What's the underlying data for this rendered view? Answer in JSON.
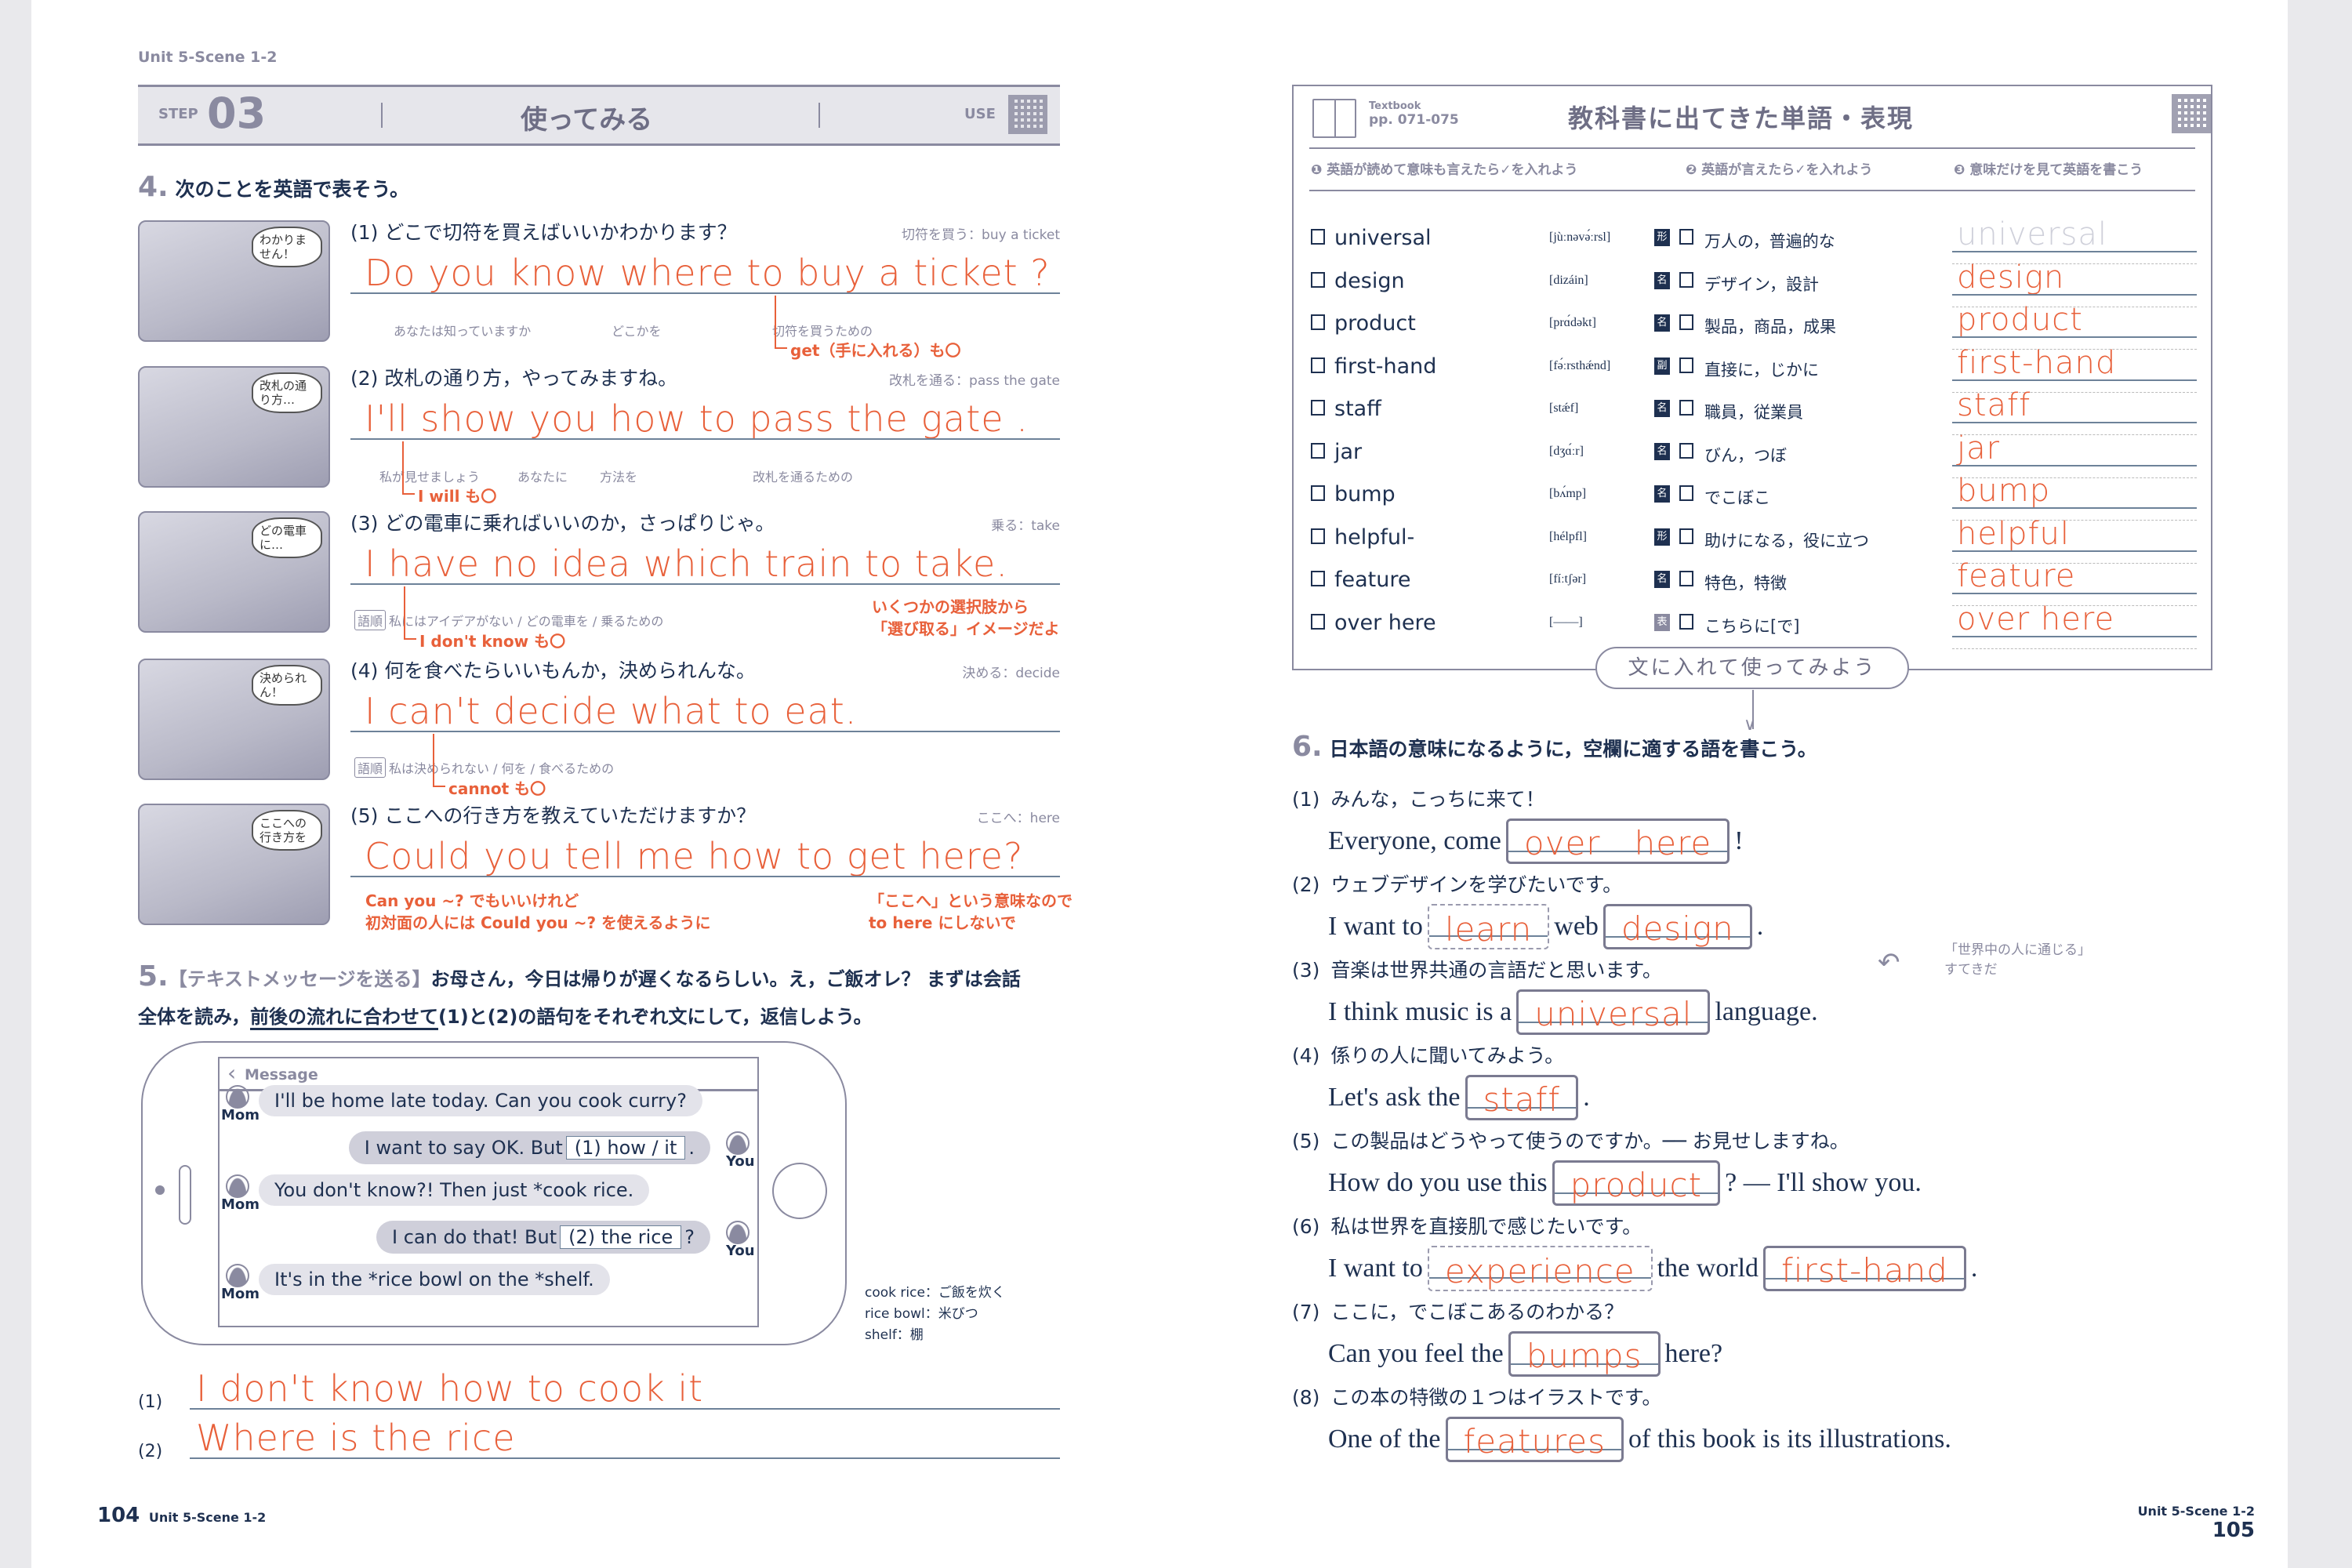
{
  "colors": {
    "accent": "#e8603a",
    "navy": "#1e3050",
    "muted": "#8a8aa0"
  },
  "left": {
    "unit_label": "Unit 5-Scene 1-2",
    "step": {
      "label": "STEP",
      "number": "03",
      "title": "使ってみる",
      "use": "USE",
      "qr_icon": "qr-code-icon"
    },
    "sec4": {
      "num": "4.",
      "title": "次のことを英語で表そう。",
      "items": [
        {
          "no": "(1)",
          "prompt": "どこで切符を買えばいいかわかります？",
          "hint": "切符を買う：buy a ticket",
          "bubble": "わかりません！",
          "answer": "Do you know where to buy a ticket ?",
          "subs": [
            "あなたは知っていますか",
            "どこかを",
            "切符を買うための"
          ],
          "note": "get（手に入れる）も〇",
          "side": []
        },
        {
          "no": "(2)",
          "prompt": "改札の通り方，やってみますね。",
          "hint": "改札を通る：pass the gate",
          "bubble": "改札の通り方…",
          "answer": "I'll show you how to pass the gate .",
          "subs": [
            "私が見せましょう",
            "あなたに",
            "方法を",
            "改札を通るための"
          ],
          "note": "I will も〇",
          "side": []
        },
        {
          "no": "(3)",
          "prompt": "どの電車に乗ればいいのか，さっぱりじゃ。",
          "hint": "乗る：take",
          "bubble": "どの電車に…",
          "answer": "I have no idea which train to take.",
          "badge": "語順",
          "subs": [
            "私にはアイデアがない / どの電車を / 乗るための"
          ],
          "note": "I don't know も〇",
          "side": [
            "いくつかの選択肢から",
            "「選び取る」イメージだよ"
          ]
        },
        {
          "no": "(4)",
          "prompt": "何を食べたらいいもんか，決められんな。",
          "hint": "決める：decide",
          "bubble": "決められん！",
          "answer": "I can't decide what to eat.",
          "badge": "語順",
          "subs": [
            "私は決められない / 何を / 食べるための"
          ],
          "note": "cannot も〇",
          "side": []
        },
        {
          "no": "(5)",
          "prompt": "ここへの行き方を教えていただけますか？",
          "hint": "ここへ：here",
          "bubble": "ここへの行き方を",
          "answer": "Could you tell me how to get here?",
          "subs": [],
          "note": "Can you ~? でもいいけれど",
          "note2": "初対面の人には Could you ~? を使えるように",
          "side": [
            "「ここへ」という意味なので",
            "to here にしないで"
          ]
        }
      ]
    },
    "sec5": {
      "num": "5.",
      "tag": "【テキストメッセージを送る】",
      "line1": "お母さん，今日は帰りが遅くなるらしい。え，ご飯オレ？ まずは会話",
      "line2a": "全体を読み，",
      "line2u": "前後の流れに合わせて",
      "line2b": "(1)と(2)の語句をそれぞれ文にして，返信しよう。",
      "phone": {
        "header": "Message",
        "messages": [
          {
            "who": "Mom",
            "text": "I'll be home late today.  Can you cook curry?"
          },
          {
            "who": "You",
            "pre": "I want to say OK.  But",
            "blank": "(1)  how / it",
            "post": "."
          },
          {
            "who": "Mom",
            "text": "You don't know?!  Then just *cook rice."
          },
          {
            "who": "You",
            "pre": "I can do that!  But",
            "blank": "(2)  the rice",
            "post": "?"
          },
          {
            "who": "Mom",
            "text": "It's in the *rice bowl on the *shelf."
          }
        ]
      },
      "glossary": [
        "cook rice：ご飯を炊く",
        "rice bowl：米びつ",
        "shelf：棚"
      ],
      "answers": [
        {
          "no": "(1)",
          "text": "I don't know how to cook it"
        },
        {
          "no": "(2)",
          "text": "Where is the rice"
        }
      ]
    },
    "footer": {
      "page": "104",
      "unit": "Unit 5-Scene 1-2"
    }
  },
  "right": {
    "vocab": {
      "textbook_label": "Textbook",
      "pages": "pp. 071-075",
      "title": "教科書に出てきた単語・表現",
      "col1": "❶ 英語が読めて意味も言えたら✓を入れよう",
      "col2": "❷ 英語が言えたら✓を入れよう",
      "col3": "❸ 意味だけを見て英語を書こう",
      "rows": [
        {
          "word": "universal",
          "ipa": "[jùːnəvə́ːrsl]",
          "pos": "形",
          "meaning": "万人の，普遍的な",
          "written": "universal",
          "sample": true
        },
        {
          "word": "design",
          "ipa": "[dizáin]",
          "pos": "名",
          "meaning": "デザイン，設計",
          "written": "design"
        },
        {
          "word": "product",
          "ipa": "[prɑ́dəkt]",
          "pos": "名",
          "meaning": "製品，商品，成果",
          "written": "product"
        },
        {
          "word": "first-hand",
          "ipa": "[fə́ːrsthǽnd]",
          "pos": "副",
          "meaning": "直接に，じかに",
          "written": "first-hand"
        },
        {
          "word": "staff",
          "ipa": "[stǽf]",
          "pos": "名",
          "meaning": "職員，従業員",
          "written": "staff"
        },
        {
          "word": "jar",
          "ipa": "[dʒɑ́ːr]",
          "pos": "名",
          "meaning": "びん，つぼ",
          "written": "jar"
        },
        {
          "word": "bump",
          "ipa": "[bʌ́mp]",
          "pos": "名",
          "meaning": "でこぼこ",
          "written": "bump"
        },
        {
          "word": "helpful-",
          "ipa": "[hélpfl]",
          "pos": "形",
          "meaning": "助けになる，役に立つ",
          "written": "helpful"
        },
        {
          "word": "feature",
          "ipa": "[fíːtʃər]",
          "pos": "名",
          "meaning": "特色，特徴",
          "written": "feature"
        },
        {
          "word": "over here",
          "ipa": "[――]",
          "pos": "表",
          "meaning": "こちらに[で]",
          "written": "over here"
        }
      ],
      "pill": "文に入れて使ってみよう"
    },
    "sec6": {
      "num": "6.",
      "title": "日本語の意味になるように，空欄に適する語を書こう。",
      "side_note": [
        "「世界中の人に通じる」",
        "すてきだ"
      ],
      "items": [
        {
          "no": "(1)",
          "jp": "みんな，こっちに来て！",
          "parts": [
            {
              "t": "Everyone, come"
            },
            {
              "a": "over   here"
            },
            {
              "t": "!"
            }
          ]
        },
        {
          "no": "(2)",
          "jp": "ウェブデザインを学びたいです。",
          "parts": [
            {
              "t": "I want to"
            },
            {
              "a": "learn",
              "dashed": true
            },
            {
              "t": "web"
            },
            {
              "a": "design"
            },
            {
              "t": "."
            }
          ]
        },
        {
          "no": "(3)",
          "jp": "音楽は世界共通の言語だと思います。",
          "parts": [
            {
              "t": "I think music is a"
            },
            {
              "a": "universal"
            },
            {
              "t": "language."
            }
          ]
        },
        {
          "no": "(4)",
          "jp": "係りの人に聞いてみよう。",
          "parts": [
            {
              "t": "Let's ask the"
            },
            {
              "a": "staff"
            },
            {
              "t": "."
            }
          ]
        },
        {
          "no": "(5)",
          "jp": "この製品はどうやって使うのですか。── お見せしますね。",
          "parts": [
            {
              "t": "How do you use this"
            },
            {
              "a": "product"
            },
            {
              "t": "? — I'll show you."
            }
          ]
        },
        {
          "no": "(6)",
          "jp": "私は世界を直接肌で感じたいです。",
          "parts": [
            {
              "t": "I want to"
            },
            {
              "a": "experience",
              "dashed": true
            },
            {
              "t": "the world"
            },
            {
              "a": "first-hand"
            },
            {
              "t": "."
            }
          ]
        },
        {
          "no": "(7)",
          "jp": "ここに，でこぼこあるのわかる？",
          "parts": [
            {
              "t": "Can you feel the"
            },
            {
              "a": "bumps"
            },
            {
              "t": "here?"
            }
          ]
        },
        {
          "no": "(8)",
          "jp": "この本の特徴の１つはイラストです。",
          "parts": [
            {
              "t": "One of the"
            },
            {
              "a": "features"
            },
            {
              "t": "of this book is its illustrations."
            }
          ]
        }
      ]
    },
    "footer": {
      "unit": "Unit 5-Scene 1-2",
      "page": "105"
    }
  }
}
